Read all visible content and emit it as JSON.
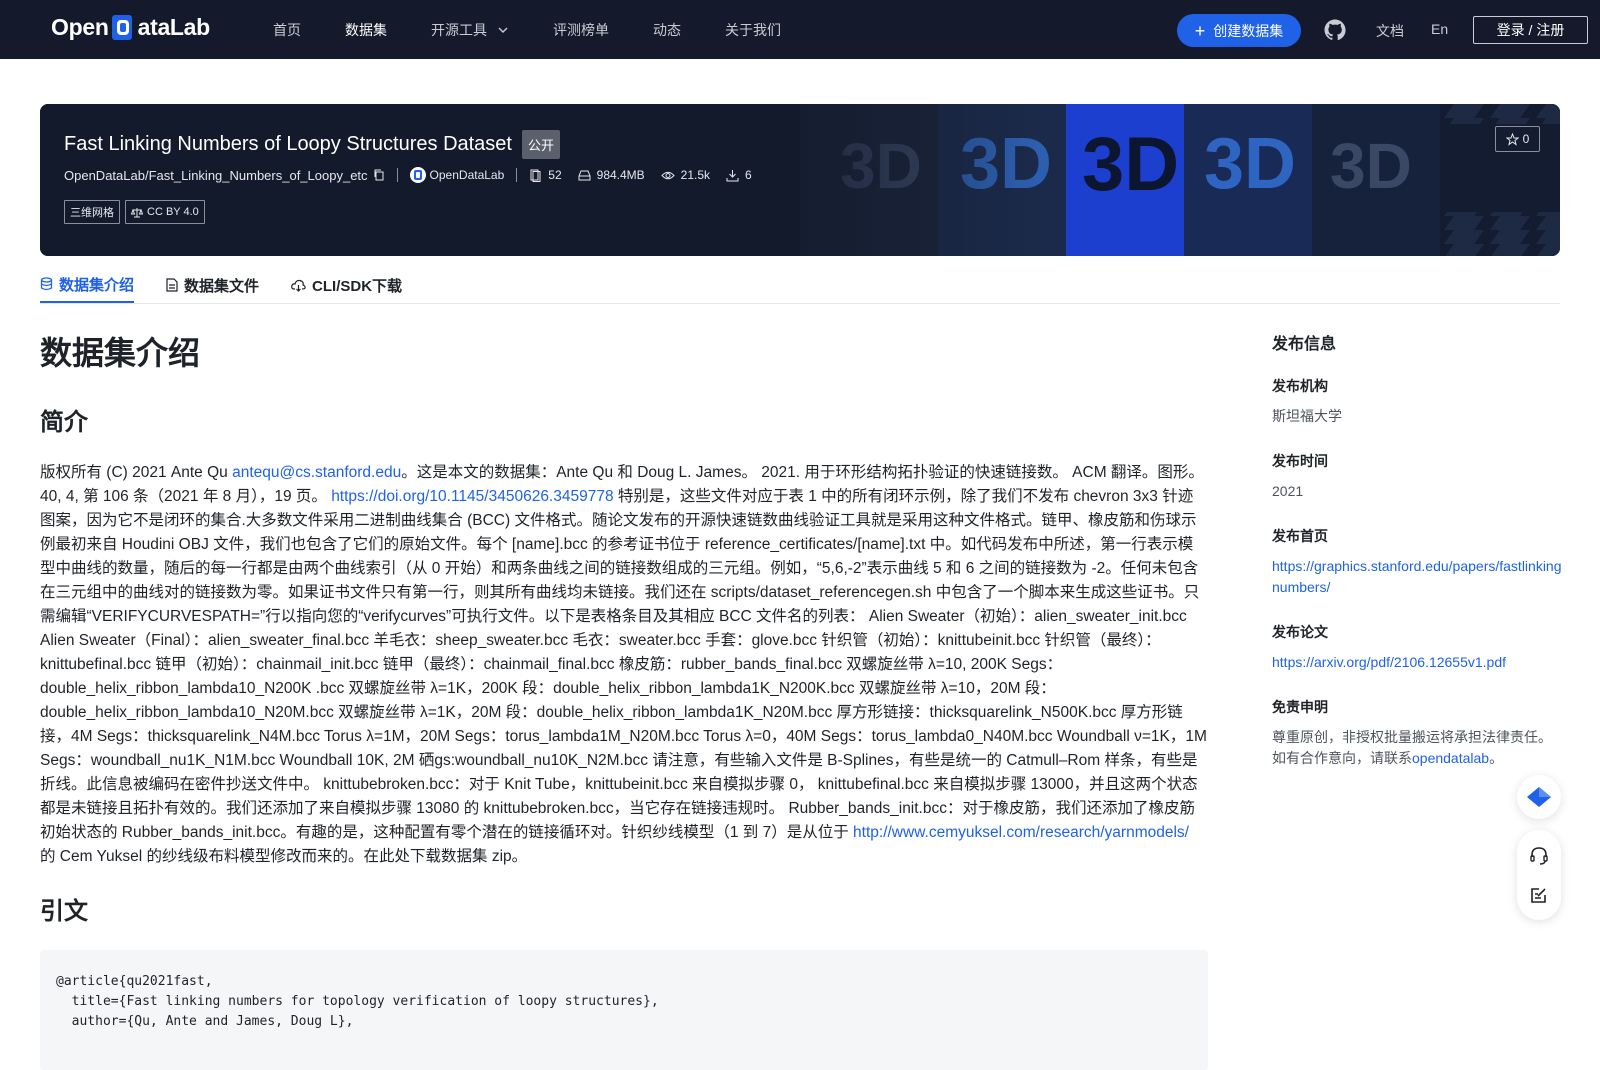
{
  "nav": {
    "logo": {
      "pre": "Open",
      "post": "ataLab"
    },
    "links": [
      "首页",
      "数据集",
      "开源工具",
      "评测榜单",
      "动态",
      "关于我们"
    ],
    "active_index": 1,
    "create_label": "创建数据集",
    "docs_label": "文档",
    "lang_label": "En",
    "login_label": "登录 / 注册"
  },
  "banner": {
    "title": "Fast Linking Numbers of Loopy Structures Dataset",
    "visibility": "公开",
    "repo_path": "OpenDataLab/Fast_Linking_Numbers_of_Loopy_etc",
    "org": "OpenDataLab",
    "stats": {
      "files": "52",
      "size": "984.4MB",
      "views": "21.5k",
      "downloads": "6"
    },
    "tags": [
      "三维网格",
      "CC BY 4.0"
    ],
    "stars": "0",
    "bg_text": [
      "3D",
      "3D",
      "3D",
      "3D",
      "3D"
    ]
  },
  "tabs": [
    "数据集介绍",
    "数据集文件",
    "CLI/SDK下载"
  ],
  "main": {
    "page_title": "数据集介绍",
    "intro_heading": "简介",
    "intro": {
      "t1": "版权所有 (C) 2021 Ante Qu ",
      "email": "antequ@cs.stanford.edu",
      "t2": "。这是本文的数据集：Ante Qu 和 Doug L. James。 2021. 用于环形结构拓扑验证的快速链接数。 ACM 翻译。图形。 40, 4, 第 106 条（2021 年 8 月），19 页。 ",
      "doi": "https://doi.org/10.1145/3450626.3459778",
      "t3": " 特别是，这些文件对应于表 1 中的所有闭环示例，除了我们不发布 chevron 3x3 针迹图案，因为它不是闭环的集合.大多数文件采用二进制曲线集合 (BCC) 文件格式。随论文发布的开源快速链数曲线验证工具就是采用这种文件格式。链甲、橡皮筋和伤球示例最初来自 Houdini OBJ 文件，我们也包含了它们的原始文件。每个 [name].bcc 的参考证书位于 reference_certificates/[name].txt 中。如代码发布中所述，第一行表示模型中曲线的数量，随后的每一行都是由两个曲线索引（从 0 开始）和两条曲线之间的链接数组成的三元组。例如，“5,6,-2”表示曲线 5 和 6 之间的链接数为 -2。任何未包含在三元组中的曲线对的链接数为零。如果证书文件只有第一行，则其所有曲线均未链接。我们还在 scripts/dataset_referencegen.sh 中包含了一个脚本来生成这些证书。只需编辑“VERIFYCURVESPATH=”行以指向您的“verifycurves”可执行文件。以下是表格条目及其相应 BCC 文件名的列表： Alien Sweater（初始）：alien_sweater_init.bcc Alien Sweater（Final）：alien_sweater_final.bcc 羊毛衣：sheep_sweater.bcc 毛衣：sweater.bcc 手套：glove.bcc 针织管（初始）：knittubeinit.bcc 针织管（最终）：knittubefinal.bcc 链甲（初始）：chainmail_init.bcc 链甲（最终）：chainmail_final.bcc 橡皮筋：rubber_bands_final.bcc 双螺旋丝带 λ=10, 200K Segs：double_helix_ribbon_lambda10_N200K .bcc 双螺旋丝带 λ=1K，200K 段：double_helix_ribbon_lambda1K_N200K.bcc 双螺旋丝带 λ=10，20M 段：double_helix_ribbon_lambda10_N20M.bcc 双螺旋丝带 λ=1K，20M 段：double_helix_ribbon_lambda1K_N20M.bcc 厚方形链接：thicksquarelink_N500K.bcc 厚方形链接，4M Segs：thicksquarelink_N4M.bcc Torus λ=1M，20M Segs：torus_lambda1M_N20M.bcc Torus λ=0，40M Segs：torus_lambda0_N40M.bcc Woundball ν=1K，1M Segs：woundball_nu1K_N1M.bcc Woundball 10K, 2M 硒gs:woundball_nu10K_N2M.bcc 请注意，有些输入文件是 B-Splines，有些是统一的 Catmull–Rom 样条，有些是折线。此信息被编码在密件抄送文件中。 knittubebroken.bcc：对于 Knit Tube，knittubeinit.bcc 来自模拟步骤 0， knittubefinal.bcc 来自模拟步骤 13000，并且这两个状态都是未链接且拓扑有效的。我们还添加了来自模拟步骤 13080 的 knittubebroken.bcc，当它存在链接违规时。 Rubber_bands_init.bcc：对于橡皮筋，我们还添加了橡皮筋初始状态的 Rubber_bands_init.bcc。有趣的是，这种配置有零个潜在的链接循环对。针织纱线模型（1 到 7）是从位于 ",
      "url": "http://www.cemyuksel.com/research/yarnmodels/",
      "t4": " 的 Cem Yuksel 的纱线级布料模型修改而来的。在此处下载数据集 zip。"
    },
    "citation_heading": "引文",
    "citation_code": "@article{qu2021fast,\n  title={Fast linking numbers for topology verification of loopy structures},\n  author={Qu, Ante and James, Doug L},"
  },
  "sidebar": {
    "heading": "发布信息",
    "org_label": "发布机构",
    "org_value": "斯坦福大学",
    "time_label": "发布时间",
    "time_value": "2021",
    "homepage_label": "发布首页",
    "homepage_value": "https://graphics.stanford.edu/papers/fastlinkingnumbers/",
    "paper_label": "发布论文",
    "paper_value": "https://arxiv.org/pdf/2106.12655v1.pdf",
    "disclaimer_label": "免责申明",
    "disclaimer_text": "尊重原创，非授权批量搬运将承担法律责任。如有合作意向，请联系",
    "disclaimer_link": "opendatalab",
    "disclaimer_end": "。"
  },
  "colors": {
    "nav_bg": "#141a2b",
    "accent": "#1f62e8",
    "banner_bg": "#12192b"
  }
}
